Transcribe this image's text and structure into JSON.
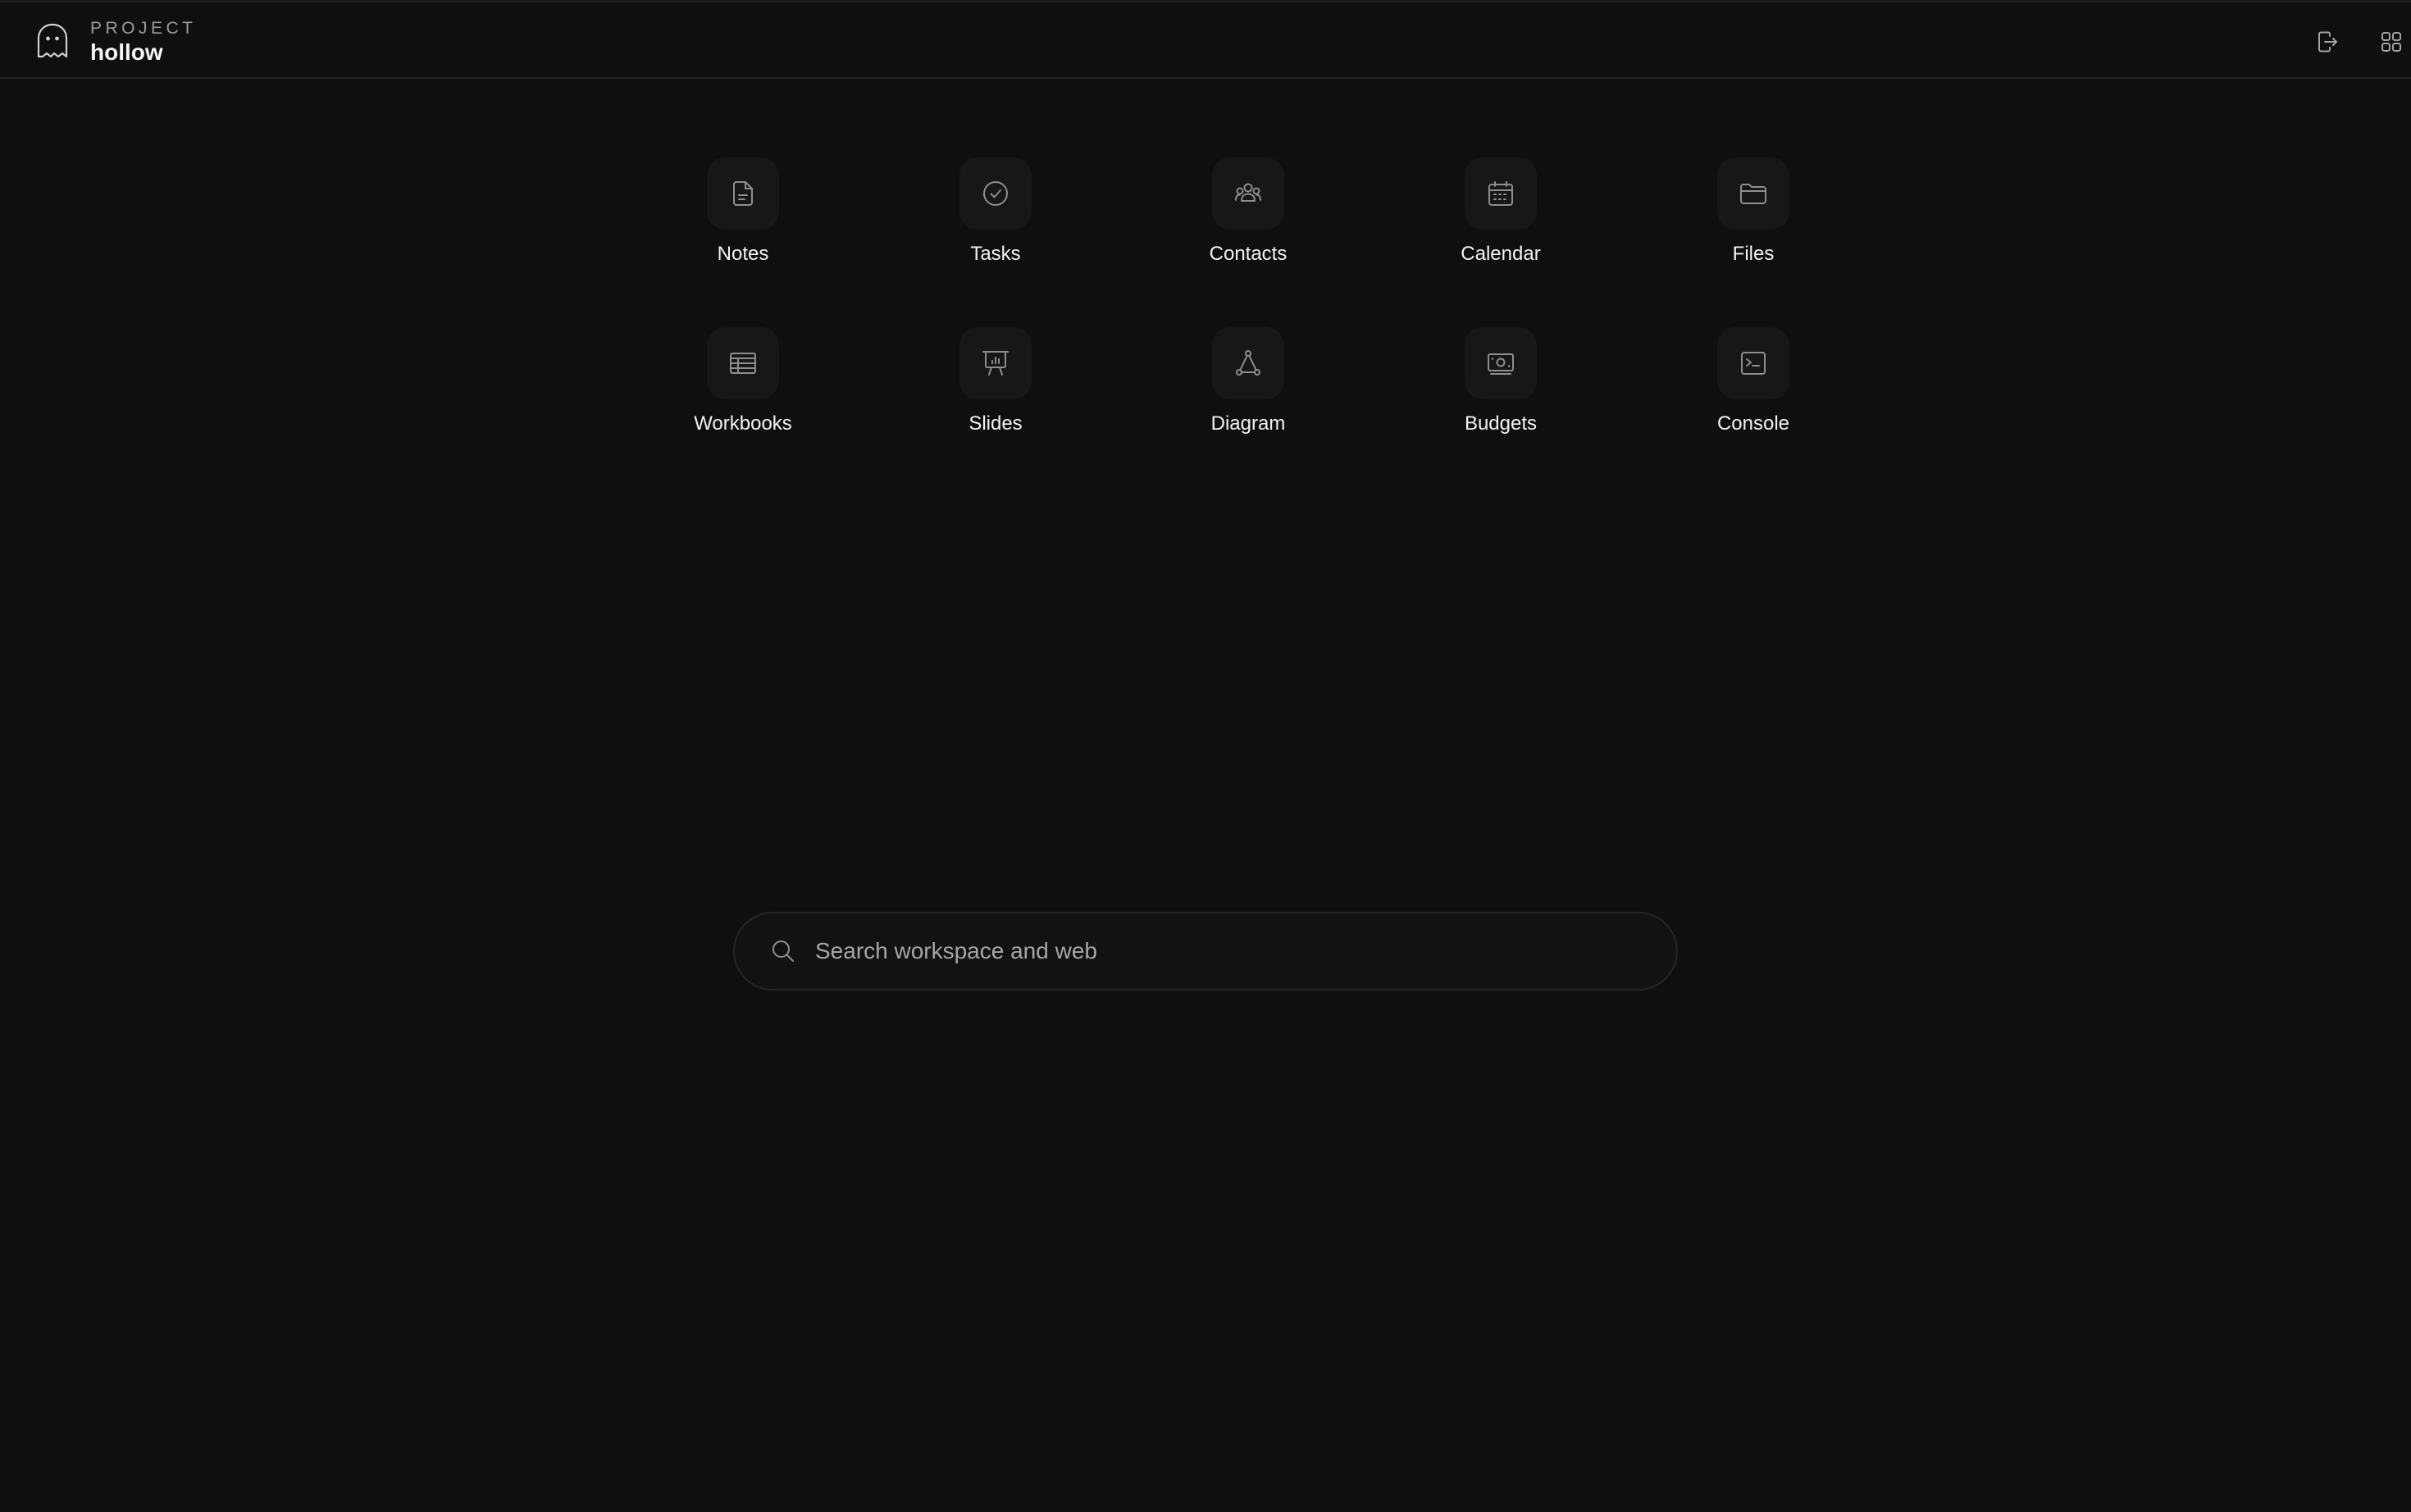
{
  "brand": {
    "kicker": "PROJECT",
    "name": "hollow",
    "logo_icon": "ghost-icon"
  },
  "topbar": {
    "actions": [
      {
        "icon": "logout-icon"
      },
      {
        "icon": "apps-grid-icon"
      }
    ]
  },
  "apps": [
    {
      "label": "Notes",
      "icon": "document-icon"
    },
    {
      "label": "Tasks",
      "icon": "check-circle-icon"
    },
    {
      "label": "Contacts",
      "icon": "users-icon"
    },
    {
      "label": "Calendar",
      "icon": "calendar-icon"
    },
    {
      "label": "Files",
      "icon": "folder-icon"
    },
    {
      "label": "Workbooks",
      "icon": "table-icon"
    },
    {
      "label": "Slides",
      "icon": "presentation-icon"
    },
    {
      "label": "Diagram",
      "icon": "diagram-icon"
    },
    {
      "label": "Budgets",
      "icon": "money-icon"
    },
    {
      "label": "Console",
      "icon": "terminal-icon"
    }
  ],
  "search": {
    "placeholder": "Search workspace and web",
    "value": ""
  },
  "colors": {
    "background": "#0f0f0f",
    "tile": "#171717",
    "border": "#262626",
    "text": "#f2f2f2",
    "muted": "#9a9a9a",
    "icon": "#8e8e8e"
  }
}
